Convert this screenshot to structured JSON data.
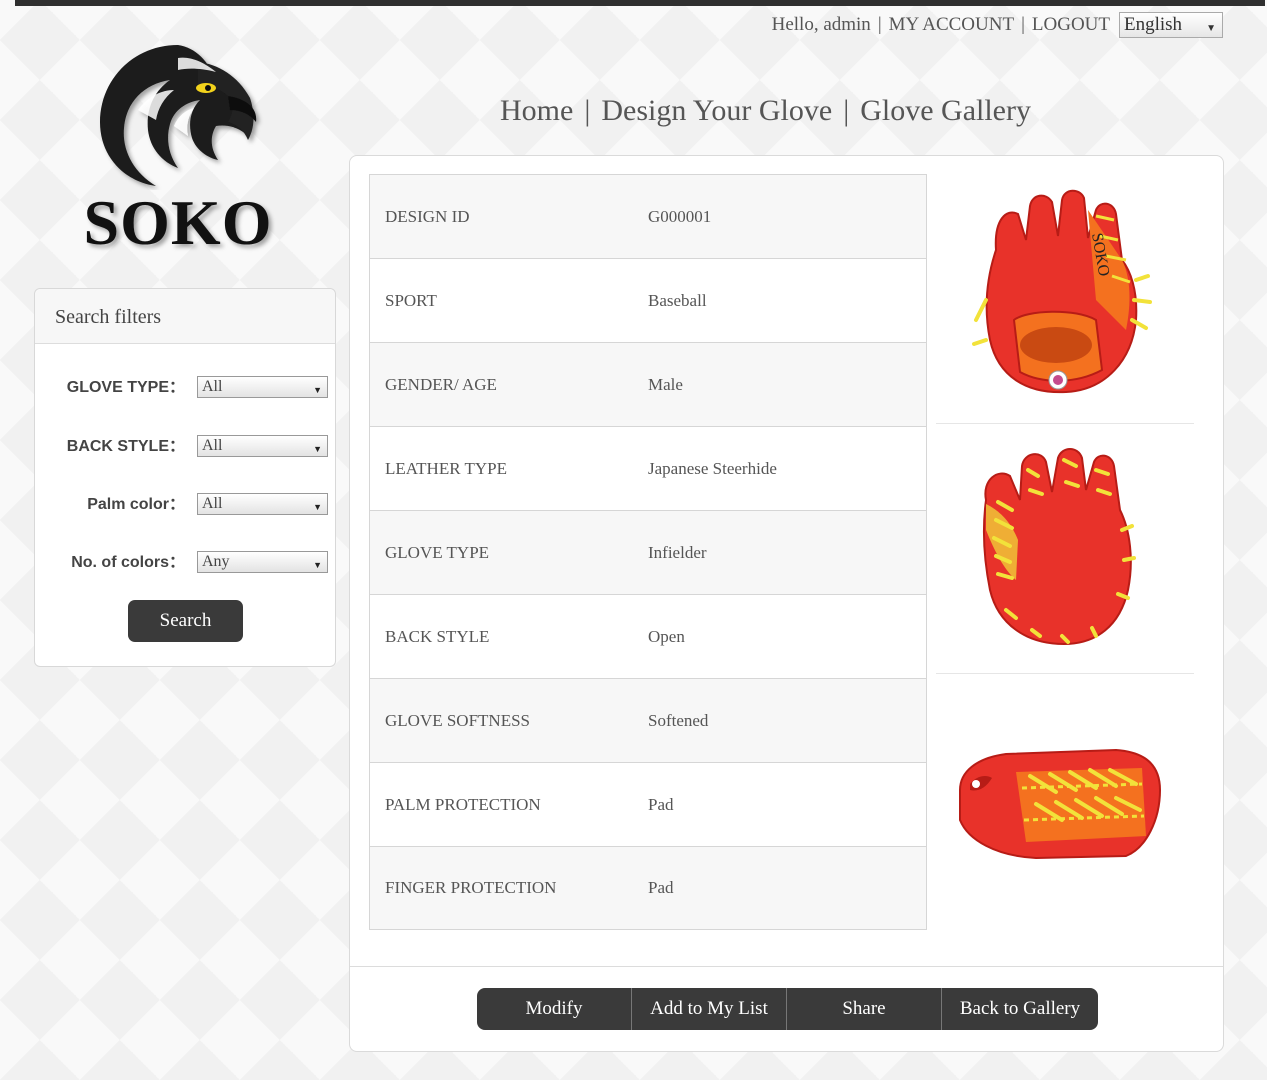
{
  "userbar": {
    "greeting": "Hello, admin",
    "sep1": "|",
    "my_account": "MY ACCOUNT",
    "sep2": "|",
    "logout": "LOGOUT",
    "language": "English"
  },
  "logo": {
    "text": "SOKO"
  },
  "nav": {
    "items": [
      {
        "label": "Home"
      },
      {
        "label": "Design Your Glove"
      },
      {
        "label": "Glove Gallery"
      }
    ],
    "separator": "|"
  },
  "filters": {
    "title": "Search filters",
    "fields": [
      {
        "label": "GLOVE TYPE：",
        "value": "All"
      },
      {
        "label": "BACK STYLE：",
        "value": "All"
      },
      {
        "label": "Palm color：",
        "value": "All"
      },
      {
        "label": "No. of colors：",
        "value": "Any"
      }
    ],
    "search_label": "Search"
  },
  "spec": [
    {
      "key": "DESIGN ID",
      "value": "G000001"
    },
    {
      "key": "SPORT",
      "value": "Baseball"
    },
    {
      "key": "GENDER/ AGE",
      "value": "Male"
    },
    {
      "key": "LEATHER TYPE",
      "value": "Japanese Steerhide"
    },
    {
      "key": "GLOVE TYPE",
      "value": "Infielder"
    },
    {
      "key": "BACK STYLE",
      "value": "Open"
    },
    {
      "key": "GLOVE SOFTNESS",
      "value": "Softened"
    },
    {
      "key": "PALM PROTECTION",
      "value": "Pad"
    },
    {
      "key": "FINGER PROTECTION",
      "value": "Pad"
    }
  ],
  "gallery": {
    "glove_brand": "SOKO",
    "views": [
      "back-view",
      "palm-view",
      "side-view"
    ],
    "colors": {
      "body": "#e8322a",
      "accent": "#f4711f",
      "lace": "#f2e23a"
    }
  },
  "actions": {
    "modify": "Modify",
    "add_to_list": "Add to My List",
    "share": "Share",
    "back_to_gallery": "Back to Gallery"
  }
}
